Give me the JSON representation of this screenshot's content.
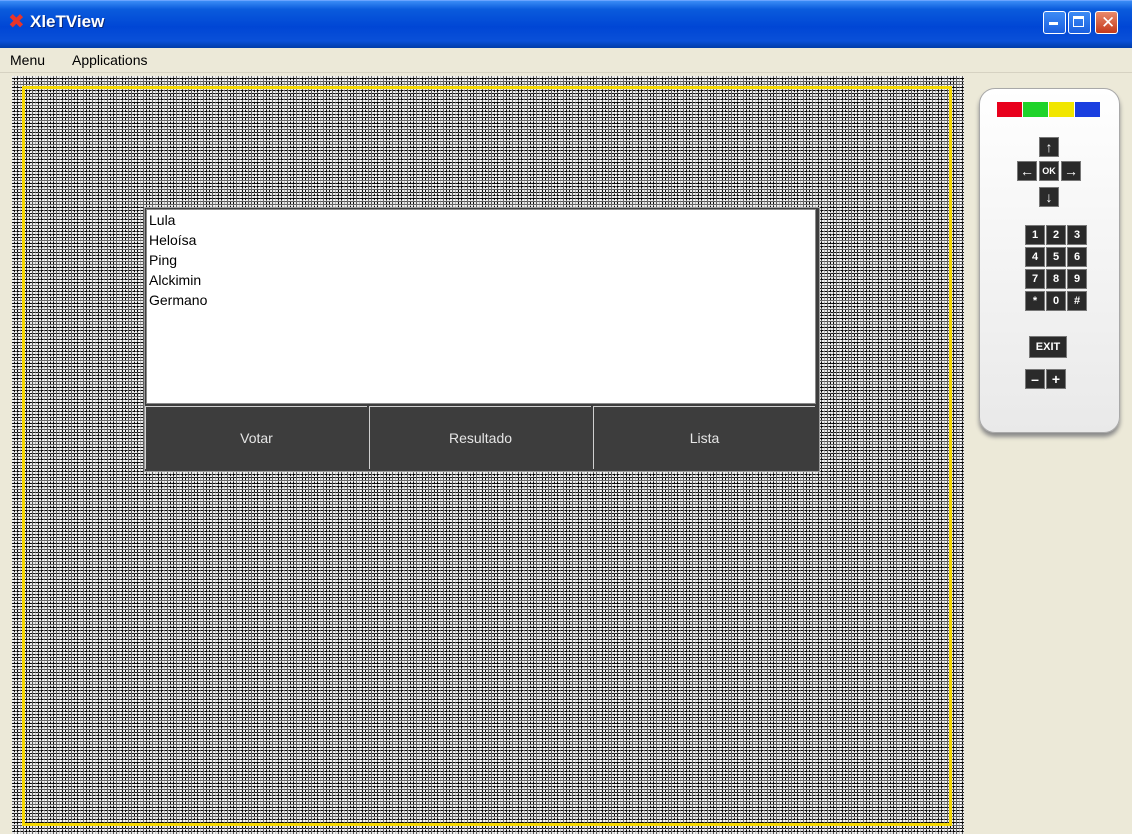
{
  "window": {
    "title": "XleTView",
    "controls": [
      "minimize-icon",
      "maximize-icon",
      "close-icon"
    ]
  },
  "menubar": {
    "items": [
      "Menu",
      "Applications"
    ]
  },
  "screen": {
    "list_items": [
      "Lula",
      "Heloísa",
      "Ping",
      "Alckimin",
      "Germano"
    ],
    "buttons": [
      "Votar",
      "Resultado",
      "Lista"
    ],
    "safe_area_color": "#f5d800"
  },
  "remote": {
    "color_keys": [
      "#e8001c",
      "#1fd32a",
      "#f1e600",
      "#1a3fe0"
    ],
    "nav": {
      "up": "↑",
      "down": "↓",
      "left": "←",
      "right": "→",
      "ok": "OK"
    },
    "digits": [
      "1",
      "2",
      "3",
      "4",
      "5",
      "6",
      "7",
      "8",
      "9",
      "*",
      "0",
      "#"
    ],
    "exit": "EXIT",
    "minus": "–",
    "plus": "+"
  }
}
